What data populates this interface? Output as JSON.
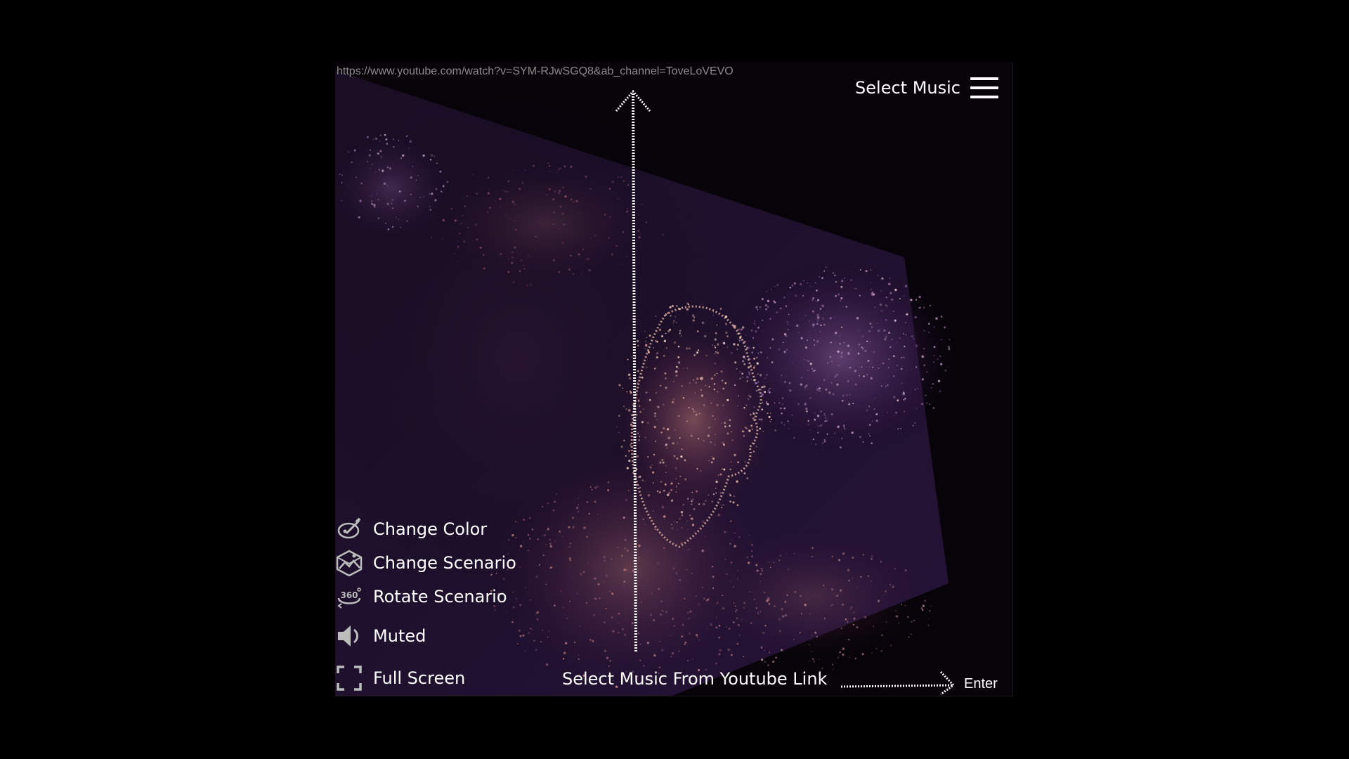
{
  "url_input": {
    "value": "https://www.youtube.com/watch?v=SYM-RJwSGQ8&ab_channel=ToveLoVEVO"
  },
  "header": {
    "select_music_label": "Select Music",
    "menu_icon": "hamburger-icon"
  },
  "controls": [
    {
      "label": "Change Color",
      "icon": "paint-palette-icon"
    },
    {
      "label": "Change Scenario",
      "icon": "landscape-cube-icon"
    },
    {
      "label": "Rotate Scenario",
      "icon": "rotate-360-icon"
    },
    {
      "label": "Muted",
      "icon": "speaker-icon"
    },
    {
      "label": "Full Screen",
      "icon": "fullscreen-icon"
    }
  ],
  "footer": {
    "prompt": "Select Music From Youtube Link",
    "enter_label": "Enter"
  },
  "colors": {
    "background": "#000000",
    "stage": "#070309",
    "text": "#ffffff",
    "url_text": "#8a8a8a",
    "points_warm": "#e8a08a",
    "points_purple": "#7a4a9a"
  }
}
